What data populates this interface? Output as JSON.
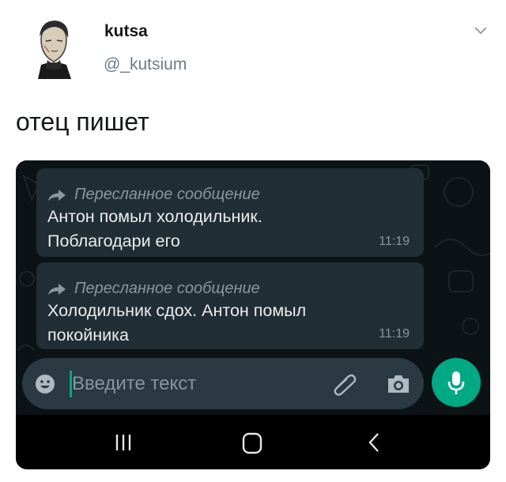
{
  "tweet": {
    "display_name": "kutsa",
    "handle": "@_kutsium",
    "text": "отец пишет"
  },
  "chat": {
    "messages": [
      {
        "forwarded_label": "Пересланное сообщение",
        "text_lines": [
          "Антон помыл холодильник.",
          "Поблагодари его"
        ],
        "time": "11:19"
      },
      {
        "forwarded_label": "Пересланное сообщение",
        "text_lines": [
          "Холодильник сдох. Антон помыл",
          "покойника"
        ],
        "time": "11:19"
      }
    ],
    "input": {
      "placeholder": "Введите текст"
    }
  },
  "icons": {
    "avatar": "avatar",
    "menu": "chevron-down-icon",
    "forwarded": "forward-arrow-icon",
    "emoji": "emoji-icon",
    "attach": "paperclip-icon",
    "camera": "camera-icon",
    "mic": "microphone-icon",
    "nav_recent": "recent-apps-icon",
    "nav_home": "home-icon",
    "nav_back": "back-icon"
  },
  "colors": {
    "accent": "#00a884",
    "bubble": "#222e35",
    "chat_background": "#0b1317",
    "input_bar": "#2a3942",
    "handle_text": "#6d7a85"
  }
}
